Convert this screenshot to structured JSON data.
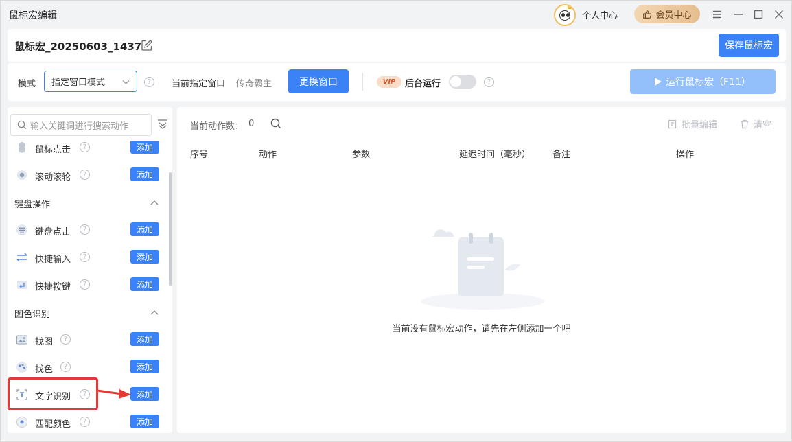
{
  "window": {
    "title": "鼠标宏编辑",
    "personal_center": "个人中心",
    "member_center": "会员中心"
  },
  "namebar": {
    "macro_name": "鼠标宏_20250603_1437",
    "save_label": "保存鼠标宏"
  },
  "modebar": {
    "mode_label": "模式",
    "mode_value": "指定窗口模式",
    "current_window_label": "当前指定窗口",
    "current_window_value": "传奇霸主",
    "change_window_label": "更换窗口",
    "vip_badge": "VIP",
    "background_run_label": "后台运行",
    "background_run_enabled": false,
    "run_label": "运行鼠标宏（F11）"
  },
  "sidebar": {
    "search_placeholder": "输入关键词进行搜索动作",
    "add_label": "添加",
    "items": [
      {
        "label": "鼠标点击",
        "icon": "mouse-icon"
      },
      {
        "label": "滚动滚轮",
        "icon": "scroll-wheel-icon"
      }
    ],
    "sections": [
      {
        "title": "键盘操作",
        "items": [
          {
            "label": "键盘点击",
            "icon": "keyboard-icon"
          },
          {
            "label": "快捷输入",
            "icon": "quick-input-icon"
          },
          {
            "label": "快捷按键",
            "icon": "hotkey-icon"
          }
        ]
      },
      {
        "title": "图色识别",
        "items": [
          {
            "label": "找图",
            "icon": "image-icon"
          },
          {
            "label": "找色",
            "icon": "palette-icon"
          },
          {
            "label": "文字识别",
            "icon": "text-recognition-icon"
          },
          {
            "label": "匹配颜色",
            "icon": "color-match-icon"
          }
        ]
      }
    ]
  },
  "main": {
    "count_label": "当前动作数：",
    "count_value": "0",
    "batch_edit_label": "批量编辑",
    "clear_label": "清空",
    "columns": [
      "序号",
      "动作",
      "参数",
      "延迟时间（毫秒）",
      "备注",
      "操作"
    ],
    "empty_text": "当前没有鼠标宏动作，请先在左侧添加一个吧"
  },
  "colors": {
    "primary": "#3b82f6",
    "primary_disabled": "#93c0fa",
    "highlight": "#e53935",
    "vip_text": "#d0592c"
  }
}
